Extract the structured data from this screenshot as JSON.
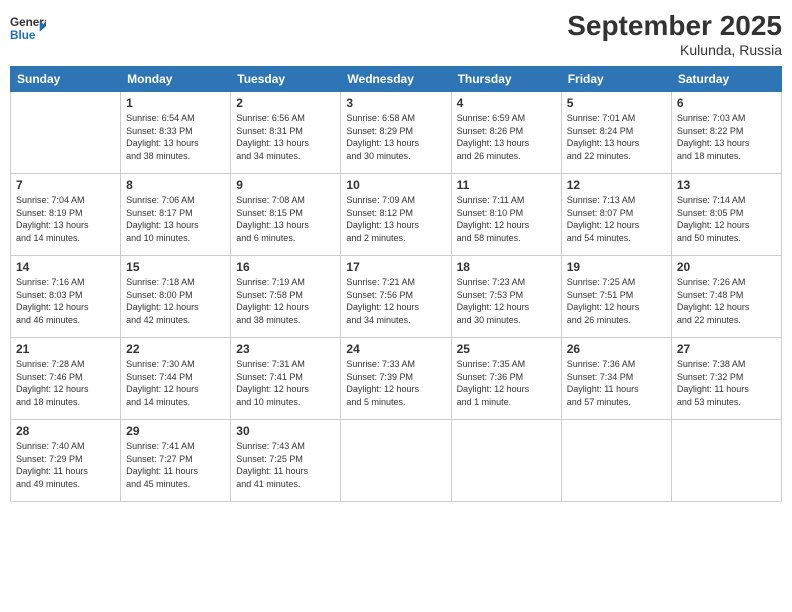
{
  "header": {
    "logo_general": "General",
    "logo_blue": "Blue",
    "title": "September 2025",
    "subtitle": "Kulunda, Russia"
  },
  "days_of_week": [
    "Sunday",
    "Monday",
    "Tuesday",
    "Wednesday",
    "Thursday",
    "Friday",
    "Saturday"
  ],
  "weeks": [
    [
      {
        "day": "",
        "info": ""
      },
      {
        "day": "1",
        "info": "Sunrise: 6:54 AM\nSunset: 8:33 PM\nDaylight: 13 hours\nand 38 minutes."
      },
      {
        "day": "2",
        "info": "Sunrise: 6:56 AM\nSunset: 8:31 PM\nDaylight: 13 hours\nand 34 minutes."
      },
      {
        "day": "3",
        "info": "Sunrise: 6:58 AM\nSunset: 8:29 PM\nDaylight: 13 hours\nand 30 minutes."
      },
      {
        "day": "4",
        "info": "Sunrise: 6:59 AM\nSunset: 8:26 PM\nDaylight: 13 hours\nand 26 minutes."
      },
      {
        "day": "5",
        "info": "Sunrise: 7:01 AM\nSunset: 8:24 PM\nDaylight: 13 hours\nand 22 minutes."
      },
      {
        "day": "6",
        "info": "Sunrise: 7:03 AM\nSunset: 8:22 PM\nDaylight: 13 hours\nand 18 minutes."
      }
    ],
    [
      {
        "day": "7",
        "info": "Sunrise: 7:04 AM\nSunset: 8:19 PM\nDaylight: 13 hours\nand 14 minutes."
      },
      {
        "day": "8",
        "info": "Sunrise: 7:06 AM\nSunset: 8:17 PM\nDaylight: 13 hours\nand 10 minutes."
      },
      {
        "day": "9",
        "info": "Sunrise: 7:08 AM\nSunset: 8:15 PM\nDaylight: 13 hours\nand 6 minutes."
      },
      {
        "day": "10",
        "info": "Sunrise: 7:09 AM\nSunset: 8:12 PM\nDaylight: 13 hours\nand 2 minutes."
      },
      {
        "day": "11",
        "info": "Sunrise: 7:11 AM\nSunset: 8:10 PM\nDaylight: 12 hours\nand 58 minutes."
      },
      {
        "day": "12",
        "info": "Sunrise: 7:13 AM\nSunset: 8:07 PM\nDaylight: 12 hours\nand 54 minutes."
      },
      {
        "day": "13",
        "info": "Sunrise: 7:14 AM\nSunset: 8:05 PM\nDaylight: 12 hours\nand 50 minutes."
      }
    ],
    [
      {
        "day": "14",
        "info": "Sunrise: 7:16 AM\nSunset: 8:03 PM\nDaylight: 12 hours\nand 46 minutes."
      },
      {
        "day": "15",
        "info": "Sunrise: 7:18 AM\nSunset: 8:00 PM\nDaylight: 12 hours\nand 42 minutes."
      },
      {
        "day": "16",
        "info": "Sunrise: 7:19 AM\nSunset: 7:58 PM\nDaylight: 12 hours\nand 38 minutes."
      },
      {
        "day": "17",
        "info": "Sunrise: 7:21 AM\nSunset: 7:56 PM\nDaylight: 12 hours\nand 34 minutes."
      },
      {
        "day": "18",
        "info": "Sunrise: 7:23 AM\nSunset: 7:53 PM\nDaylight: 12 hours\nand 30 minutes."
      },
      {
        "day": "19",
        "info": "Sunrise: 7:25 AM\nSunset: 7:51 PM\nDaylight: 12 hours\nand 26 minutes."
      },
      {
        "day": "20",
        "info": "Sunrise: 7:26 AM\nSunset: 7:48 PM\nDaylight: 12 hours\nand 22 minutes."
      }
    ],
    [
      {
        "day": "21",
        "info": "Sunrise: 7:28 AM\nSunset: 7:46 PM\nDaylight: 12 hours\nand 18 minutes."
      },
      {
        "day": "22",
        "info": "Sunrise: 7:30 AM\nSunset: 7:44 PM\nDaylight: 12 hours\nand 14 minutes."
      },
      {
        "day": "23",
        "info": "Sunrise: 7:31 AM\nSunset: 7:41 PM\nDaylight: 12 hours\nand 10 minutes."
      },
      {
        "day": "24",
        "info": "Sunrise: 7:33 AM\nSunset: 7:39 PM\nDaylight: 12 hours\nand 5 minutes."
      },
      {
        "day": "25",
        "info": "Sunrise: 7:35 AM\nSunset: 7:36 PM\nDaylight: 12 hours\nand 1 minute."
      },
      {
        "day": "26",
        "info": "Sunrise: 7:36 AM\nSunset: 7:34 PM\nDaylight: 11 hours\nand 57 minutes."
      },
      {
        "day": "27",
        "info": "Sunrise: 7:38 AM\nSunset: 7:32 PM\nDaylight: 11 hours\nand 53 minutes."
      }
    ],
    [
      {
        "day": "28",
        "info": "Sunrise: 7:40 AM\nSunset: 7:29 PM\nDaylight: 11 hours\nand 49 minutes."
      },
      {
        "day": "29",
        "info": "Sunrise: 7:41 AM\nSunset: 7:27 PM\nDaylight: 11 hours\nand 45 minutes."
      },
      {
        "day": "30",
        "info": "Sunrise: 7:43 AM\nSunset: 7:25 PM\nDaylight: 11 hours\nand 41 minutes."
      },
      {
        "day": "",
        "info": ""
      },
      {
        "day": "",
        "info": ""
      },
      {
        "day": "",
        "info": ""
      },
      {
        "day": "",
        "info": ""
      }
    ]
  ]
}
